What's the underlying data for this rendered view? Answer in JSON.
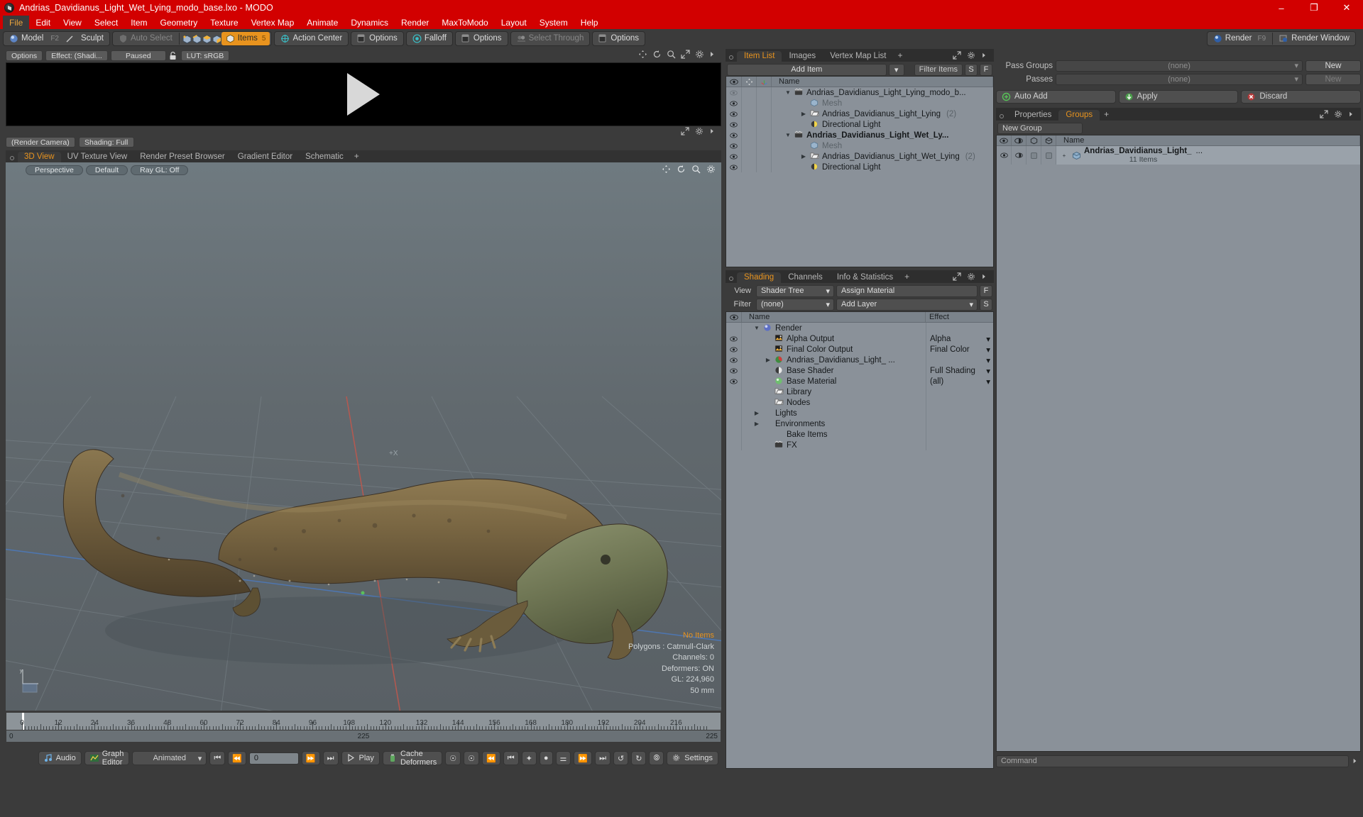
{
  "window": {
    "title": "Andrias_Davidianus_Light_Wet_Lying_modo_base.lxo - MODO",
    "minimize": "–",
    "maximize": "❐",
    "close": "✕"
  },
  "menu": [
    "File",
    "Edit",
    "View",
    "Select",
    "Item",
    "Geometry",
    "Texture",
    "Vertex Map",
    "Animate",
    "Dynamics",
    "Render",
    "MaxToModo",
    "Layout",
    "System",
    "Help"
  ],
  "toolbar": {
    "mode": {
      "model": "Model",
      "model_key": "F2",
      "sculpt": "Sculpt"
    },
    "select": {
      "auto_select": "Auto Select",
      "items": "Items",
      "items_count": "5"
    },
    "action_center": "Action Center",
    "options_1": "Options",
    "falloff": "Falloff",
    "options_2": "Options",
    "select_through": "Select Through",
    "options_3": "Options",
    "render": "Render",
    "render_key": "F9",
    "render_window": "Render Window"
  },
  "preview": {
    "options": "Options",
    "effect": "Effect: (Shadi...",
    "paused": "Paused",
    "lut": "LUT: sRGB",
    "render_camera": "(Render Camera)",
    "shading": "Shading: Full"
  },
  "viewport": {
    "tabs": [
      "3D View",
      "UV Texture View",
      "Render Preset Browser",
      "Gradient Editor",
      "Schematic"
    ],
    "active_tab": "3D View",
    "tab_plus": "+",
    "controls": [
      "Perspective",
      "Default",
      "Ray GL: Off"
    ],
    "axis_label": "+X",
    "stats": {
      "selection": "No Items",
      "polygons": "Polygons : Catmull-Clark",
      "channels": "Channels: 0",
      "deformers": "Deformers: ON",
      "gl": "GL: 224,960",
      "scale": "50 mm"
    }
  },
  "timeline": {
    "ticks": [
      "0",
      "12",
      "24",
      "36",
      "48",
      "60",
      "72",
      "84",
      "96",
      "108",
      "120",
      "132",
      "144",
      "156",
      "168",
      "180",
      "192",
      "204",
      "216"
    ],
    "range_start": "0",
    "range_center": "225",
    "range_end": "225"
  },
  "bottombar": {
    "audio": "Audio",
    "graph_editor": "Graph Editor",
    "mode": "Animated",
    "frame": "0",
    "play": "Play",
    "cache_deformers": "Cache Deformers",
    "settings": "Settings"
  },
  "item_list": {
    "tabs": [
      "Item List",
      "Images",
      "Vertex Map List"
    ],
    "active_tab": "Item List",
    "tab_plus": "+",
    "add_item": "Add Item",
    "filter_placeholder": "Filter Items",
    "filter_s": "S",
    "filter_f": "F",
    "columns": [
      "eye-column",
      "move-column",
      "axis-column",
      "Name"
    ],
    "rows": [
      {
        "name": "Andrias_Davidianus_Light_Lying_modo_b...",
        "icon": "scene-icon",
        "indent": 0,
        "twist": "▼",
        "bold": false,
        "dim": false,
        "eye": false,
        "count": ""
      },
      {
        "name": "Mesh",
        "icon": "mesh-icon",
        "indent": 1,
        "twist": "",
        "bold": false,
        "dim": true,
        "eye": true,
        "count": ""
      },
      {
        "name": "Andrias_Davidianus_Light_Lying",
        "icon": "group-icon",
        "indent": 1,
        "twist": "▶",
        "bold": false,
        "dim": false,
        "eye": true,
        "count": "(2)"
      },
      {
        "name": "Directional Light",
        "icon": "light-icon",
        "indent": 1,
        "twist": "",
        "bold": false,
        "dim": false,
        "eye": true,
        "count": ""
      },
      {
        "name": "Andrias_Davidianus_Light_Wet_Ly...",
        "icon": "scene-icon",
        "indent": 0,
        "twist": "▼",
        "bold": true,
        "dim": false,
        "eye": true,
        "count": ""
      },
      {
        "name": "Mesh",
        "icon": "mesh-icon",
        "indent": 1,
        "twist": "",
        "bold": false,
        "dim": true,
        "eye": true,
        "count": ""
      },
      {
        "name": "Andrias_Davidianus_Light_Wet_Lying",
        "icon": "group-icon",
        "indent": 1,
        "twist": "▶",
        "bold": false,
        "dim": false,
        "eye": true,
        "count": "(2)"
      },
      {
        "name": "Directional Light",
        "icon": "light-icon",
        "indent": 1,
        "twist": "",
        "bold": false,
        "dim": false,
        "eye": true,
        "count": ""
      }
    ]
  },
  "shading": {
    "tabs": [
      "Shading",
      "Channels",
      "Info & Statistics"
    ],
    "active_tab": "Shading",
    "tab_plus": "+",
    "view_label": "View",
    "view_value": "Shader Tree",
    "assign_material": "Assign Material",
    "assign_f": "F",
    "filter_label": "Filter",
    "filter_value": "(none)",
    "add_layer": "Add Layer",
    "add_layer_s": "S",
    "columns": [
      "eye-column",
      "Name",
      "Effect"
    ],
    "rows": [
      {
        "name": "Render",
        "icon": "render-icon",
        "indent": 0,
        "twist": "▼",
        "effect": "",
        "eye": false,
        "caret": false
      },
      {
        "name": "Alpha Output",
        "icon": "output-icon",
        "indent": 1,
        "twist": "",
        "effect": "Alpha",
        "eye": true,
        "caret": true
      },
      {
        "name": "Final Color Output",
        "icon": "output-icon",
        "indent": 1,
        "twist": "",
        "effect": "Final Color",
        "eye": true,
        "caret": true
      },
      {
        "name": "Andrias_Davidianus_Light_ ...",
        "icon": "material-icon",
        "indent": 1,
        "twist": "▶",
        "effect": "",
        "eye": true,
        "caret": true
      },
      {
        "name": "Base Shader",
        "icon": "shader-icon",
        "indent": 1,
        "twist": "",
        "effect": "Full Shading",
        "eye": true,
        "caret": true
      },
      {
        "name": "Base Material",
        "icon": "basematerial-icon",
        "indent": 1,
        "twist": "",
        "effect": "(all)",
        "eye": true,
        "caret": true
      },
      {
        "name": "Library",
        "icon": "folder-icon",
        "indent": 1,
        "twist": "",
        "effect": "",
        "eye": false,
        "caret": false
      },
      {
        "name": "Nodes",
        "icon": "folder-icon",
        "indent": 1,
        "twist": "",
        "effect": "",
        "eye": false,
        "caret": false
      },
      {
        "name": "Lights",
        "icon": "",
        "indent": 0,
        "twist": "▶",
        "effect": "",
        "eye": false,
        "caret": false
      },
      {
        "name": "Environments",
        "icon": "",
        "indent": 0,
        "twist": "▶",
        "effect": "",
        "eye": false,
        "caret": false
      },
      {
        "name": "Bake Items",
        "icon": "",
        "indent": 1,
        "twist": "",
        "effect": "",
        "eye": false,
        "caret": false
      },
      {
        "name": "FX",
        "icon": "fx-icon",
        "indent": 1,
        "twist": "",
        "effect": "",
        "eye": false,
        "caret": false
      }
    ]
  },
  "passes": {
    "pass_groups_label": "Pass Groups",
    "pass_groups_value": "(none)",
    "pass_groups_new": "New",
    "passes_label": "Passes",
    "passes_value": "(none)",
    "passes_new": "New",
    "auto_add": "Auto Add",
    "apply": "Apply",
    "discard": "Discard"
  },
  "groups": {
    "tabs": [
      "Properties",
      "Groups"
    ],
    "active_tab": "Groups",
    "tab_plus": "+",
    "new_group": "New Group",
    "columns": [
      "eye-column",
      "partial-eye-column",
      "box-column",
      "box2-column",
      "Name"
    ],
    "rows": [
      {
        "expand": "+",
        "name": "Andrias_Davidianus_Light_",
        "ellipsis": "...",
        "sub": "11 Items"
      }
    ]
  },
  "command": {
    "placeholder": "Command"
  }
}
